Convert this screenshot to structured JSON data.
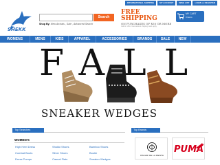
{
  "header": {
    "top_links": [
      "INTERNATIONAL SHIPPING",
      "MY ACCOUNT",
      "WISH LIST",
      "LOGIN or REGISTER"
    ],
    "logo_text": "SHEKK",
    "search": {
      "placeholder": "",
      "button_label": "Search"
    },
    "shop_by": {
      "label": "Shop By:",
      "value": "New Arrivals , Sale , Advanced Search"
    },
    "promo": {
      "line1": "FREE",
      "line2": "SHIPPING",
      "line3": "ON PURCHASES OF $50 OR MORE",
      "note": "Valid in USA. International shipping rates apply."
    },
    "cart": {
      "label": "MY CART",
      "items": "0 items"
    }
  },
  "nav": {
    "items": [
      "WOMENS",
      "MENS",
      "KIDS",
      "APPAREL",
      "ACCESSORIES",
      "BRANDS",
      "SALE",
      "NEW"
    ]
  },
  "hero": {
    "headline": "FALL",
    "subhead": "SNEAKER WEDGES"
  },
  "top_searches": {
    "title": "Top Searches",
    "category": "WOMEN'S",
    "links": [
      [
        "High Heel Dress",
        "Shokki Shoes",
        "Bamboo Shoes"
      ],
      [
        "Combat Boots",
        "Silver Shoes",
        "Bootie"
      ],
      [
        "Dress Pumps",
        "Casual Flats",
        "Sneaker Wedges"
      ]
    ]
  },
  "top_brands": {
    "title": "Top Brands",
    "brand1": "OSCAR DE LA RENTA",
    "brand2": "PUMA"
  },
  "colors": {
    "brand_blue": "#2a6fbf",
    "accent_orange": "#f26522",
    "promo_orange": "#e8540c"
  }
}
